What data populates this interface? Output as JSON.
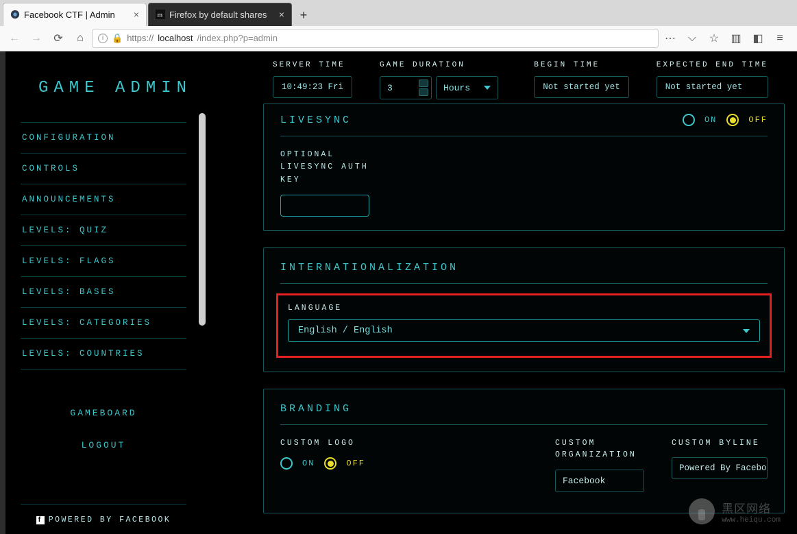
{
  "browser": {
    "tabs": [
      {
        "label": "Facebook CTF | Admin",
        "active": true
      },
      {
        "label": "Firefox by default shares",
        "active": false
      }
    ],
    "url_host": "localhost",
    "url_prefix": "https://",
    "url_path": "/index.php?p=admin"
  },
  "sidebar": {
    "title": "GAME ADMIN",
    "items": [
      "CONFIGURATION",
      "CONTROLS",
      "ANNOUNCEMENTS",
      "LEVELS: QUIZ",
      "LEVELS: FLAGS",
      "LEVELS: BASES",
      "LEVELS: CATEGORIES",
      "LEVELS: COUNTRIES"
    ],
    "actions": {
      "gameboard": "GAMEBOARD",
      "logout": "LOGOUT"
    },
    "powered": "POWERED BY FACEBOOK"
  },
  "timebar": {
    "server_time_label": "SERVER TIME",
    "server_time_value": "10:49:23 Fri",
    "game_duration_label": "GAME DURATION",
    "game_duration_value": "3",
    "game_duration_unit": "Hours",
    "begin_time_label": "BEGIN TIME",
    "begin_time_value": "Not started yet",
    "end_time_label": "EXPECTED END TIME",
    "end_time_value": "Not started yet"
  },
  "livesync": {
    "title": "LIVESYNC",
    "on": "ON",
    "off": "OFF",
    "key_label_l1": "OPTIONAL",
    "key_label_l2": "LIVESYNC AUTH",
    "key_label_l3": "KEY"
  },
  "i18n": {
    "title": "INTERNATIONALIZATION",
    "language_label": "LANGUAGE",
    "language_value": "English / English"
  },
  "branding": {
    "title": "BRANDING",
    "logo_label": "CUSTOM LOGO",
    "on": "ON",
    "off": "OFF",
    "org_label_l1": "CUSTOM",
    "org_label_l2": "ORGANIZATION",
    "org_value": "Facebook",
    "byline_label": "CUSTOM BYLINE",
    "byline_value": "Powered By Facebo"
  },
  "watermark": {
    "text": "黑区网络",
    "sub": "www.heiqu.com"
  }
}
